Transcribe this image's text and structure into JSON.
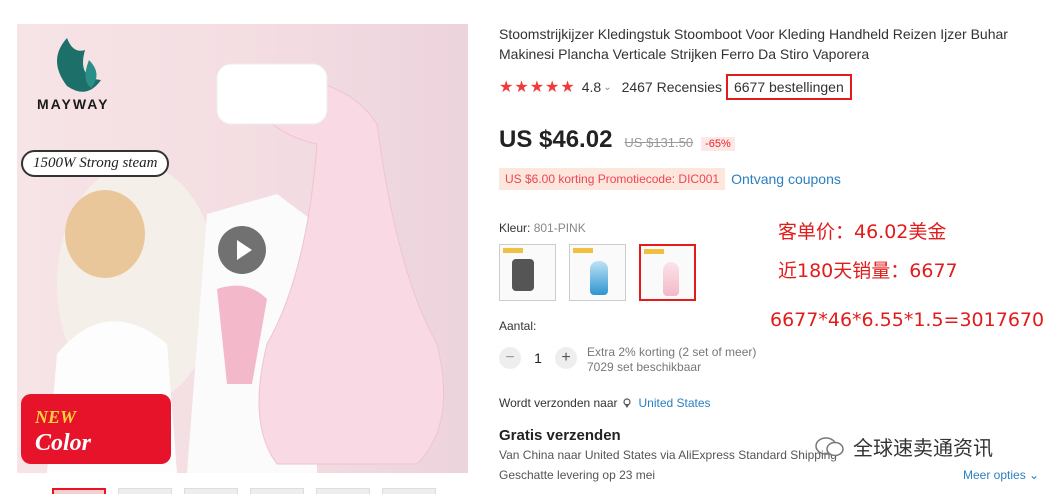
{
  "gallery": {
    "logo_text": "MAYWAY",
    "badge": "1500W  Strong steam",
    "new_label": "NEW",
    "color_label": "Color"
  },
  "product": {
    "title": "Stoomstrijkijzer Kledingstuk Stoomboot Voor Kleding Handheld Reizen Ijzer Buhar Makinesi Plancha Verticale Strijken Ferro Da Stiro Vaporera",
    "rating": "4.8",
    "reviews": "2467 Recensies",
    "orders": "6677 bestellingen",
    "price": "US $46.02",
    "original_price": "US $131.50",
    "discount": "-65%",
    "promo": "US $6.00 korting Promotiecode: DIC001",
    "coupons_link": "Ontvang coupons",
    "color_label": "Kleur:",
    "color_value": "801-PINK",
    "quantity_label": "Aantal:",
    "quantity": "1",
    "quantity_discount": "Extra 2% korting (2 set of meer)",
    "stock": "7029 set beschikbaar",
    "ship_to_label": "Wordt verzonden naar",
    "ship_to_country": "United States",
    "free_shipping": "Gratis verzenden",
    "via_text": "Van China naar United States via AliExpress Standard Shipping",
    "eta": "Geschatte levering op 23 mei",
    "more_options": "Meer opties"
  },
  "annotations": {
    "unit_price": "客单价：46.02美金",
    "sales_180": "近180天销量：6677",
    "formula": "6677*46*6.55*1.5=3017670"
  },
  "watermark": "全球速卖通资讯",
  "colors": {
    "accent_red": "#e21b1b",
    "link_blue": "#2a7fbf"
  }
}
